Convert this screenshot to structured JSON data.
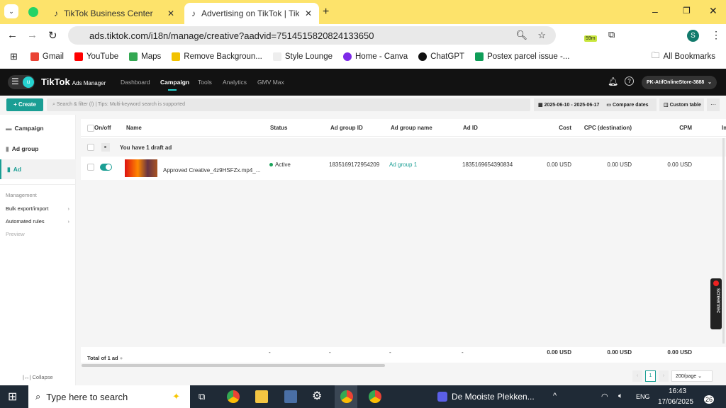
{
  "browser": {
    "tabs": [
      {
        "label": "TikTok Business Center"
      },
      {
        "label": "Advertising on TikTok | TikTok A"
      }
    ],
    "url": "ads.tiktok.com/i18n/manage/creative?aadvid=7514515820824133650",
    "extension_badge": "59m",
    "profile_initial": "S",
    "bookmarks": [
      "Gmail",
      "YouTube",
      "Maps",
      "Remove Backgroun...",
      "Style Lounge",
      "Home - Canva",
      "ChatGPT",
      "Postex parcel issue -..."
    ],
    "all_bookmarks": "All Bookmarks"
  },
  "app": {
    "logo": "TikTok",
    "logo_sub": "Ads Manager",
    "avatar_initial": "u",
    "nav": [
      "Dashboard",
      "Campaign",
      "Tools",
      "Analytics",
      "GMV Max"
    ],
    "account": "PK-AtifOnlineStore-3888"
  },
  "toolbar": {
    "create": "+ Create",
    "search_placeholder": "Search & filter (/) | Tips: Multi-keyword search is supported",
    "date_range": "2025-06-10 - 2025-06-17",
    "compare": "Compare dates",
    "custom_table": "Custom table",
    "more": "···"
  },
  "sidebar": {
    "items": [
      "Campaign",
      "Ad group",
      "Ad"
    ],
    "management": "Management",
    "links": [
      "Bulk export/import",
      "Automated rules"
    ],
    "preview": "Preview",
    "collapse": "Collapse"
  },
  "table": {
    "headers": [
      "On/off",
      "Name",
      "Status",
      "Ad group ID",
      "Ad group name",
      "Ad ID",
      "Cost",
      "CPC (destination)",
      "CPM",
      "Im"
    ],
    "draft": "You have 1 draft ad",
    "row": {
      "name": "Approved Creative_4z9HSFZx.mp4_...",
      "status": "Active",
      "ad_group_id": "1835169172954209",
      "ad_group_name": "Ad group 1",
      "ad_id": "1835169654390834",
      "cost": "0.00 USD",
      "cpc": "0.00 USD",
      "cpm": "0.00 USD"
    },
    "total": {
      "label": "Total of 1 ad",
      "dash": "-",
      "cost": "0.00 USD",
      "cpc": "0.00 USD",
      "cpm": "0.00 USD"
    }
  },
  "pagination": {
    "page": "1",
    "per_page": "200/page"
  },
  "screenrec": "screenrec",
  "taskbar": {
    "search": "Type here to search",
    "media": "De Mooiste Plekken...",
    "lang": "ENG",
    "time": "16:43",
    "date": "17/06/2025",
    "notifications": "26"
  },
  "colors": {
    "accent": "#1a9e94",
    "browser_frame": "#fde36b",
    "header": "#121212"
  }
}
